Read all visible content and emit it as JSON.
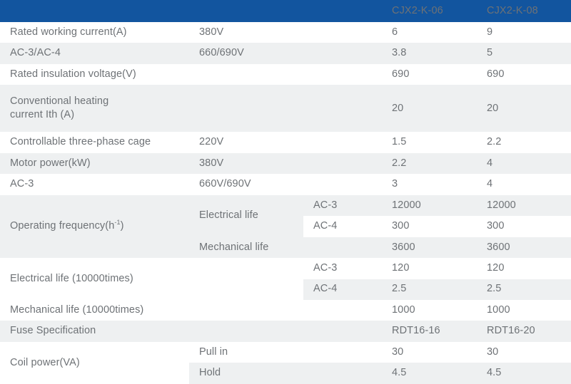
{
  "table": {
    "header": {
      "label_col": "",
      "sub_col": "",
      "subsub_col": "",
      "model_1": "CJX2-K-06",
      "model_2": "CJX2-K-08"
    },
    "colors": {
      "header_blue": "#12559f",
      "stripe_gray": "#eef0f1",
      "body_white": "#ffffff",
      "text_gray": "#6e7276",
      "header_text": "#ffffff"
    },
    "rows": [
      {
        "label": "Rated working current(A)",
        "sub": "380V",
        "subsub": "",
        "v1": "6",
        "v2": "9"
      },
      {
        "label": "AC-3/AC-4",
        "sub": "660/690V",
        "subsub": "",
        "v1": "3.8",
        "v2": "5"
      },
      {
        "label": "Rated insulation voltage(V)",
        "sub": "",
        "subsub": "",
        "v1": "690",
        "v2": "690"
      },
      {
        "label_line_1": "Conventional heating",
        "label_line_2": "current Ith (A)",
        "sub": "",
        "subsub": "",
        "v1": "20",
        "v2": "20"
      },
      {
        "label": "Controllable three-phase cage",
        "sub": "220V",
        "subsub": "",
        "v1": "1.5",
        "v2": "2.2"
      },
      {
        "label": "Motor power(kW)",
        "sub": "380V",
        "subsub": "",
        "v1": "2.2",
        "v2": "4"
      },
      {
        "label": "AC-3",
        "sub": "660V/690V",
        "subsub": "",
        "v1": "3",
        "v2": "4"
      },
      {
        "label_prefix": "Operating frequency(h",
        "label_sup": "-1",
        "label_suffix": ")",
        "sub_a": "Electrical life",
        "sub_b": "Mechanical life",
        "subsub_a": "AC-3",
        "subsub_b": "AC-4",
        "subsub_c": "",
        "a_v1": "12000",
        "a_v2": "12000",
        "b_v1": "300",
        "b_v2": "300",
        "c_v1": "3600",
        "c_v2": "3600"
      },
      {
        "label": "Electrical life (10000times)",
        "sub": "",
        "subsub_a": "AC-3",
        "subsub_b": "AC-4",
        "a_v1": "120",
        "a_v2": "120",
        "b_v1": "2.5",
        "b_v2": "2.5"
      },
      {
        "label": "Mechanical life (10000times)",
        "sub": "",
        "subsub": "",
        "v1": "1000",
        "v2": "1000"
      },
      {
        "label": "Fuse Specification",
        "sub": "",
        "subsub": "",
        "v1": "RDT16-16",
        "v2": "RDT16-20"
      },
      {
        "label": "Coil power(VA)",
        "sub_a": "Pull in",
        "sub_b": "Hold",
        "subsub": "",
        "a_v1": "30",
        "a_v2": "30",
        "b_v1": "4.5",
        "b_v2": "4.5"
      }
    ]
  }
}
